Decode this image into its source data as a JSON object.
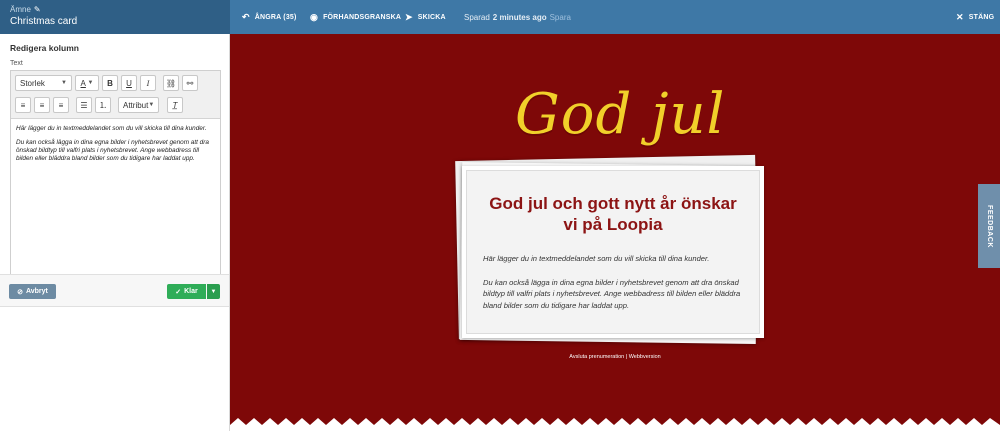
{
  "subject": {
    "label": "Ämne",
    "title": "Christmas card"
  },
  "topbar": {
    "undo": "ÅNGRA (35)",
    "preview": "FÖRHANDSGRANSKA",
    "send": "SKICKA",
    "saved_prefix": "Sparad",
    "saved_time": "2 minutes ago",
    "save_link": "Spara",
    "close": "STÄNG"
  },
  "panel": {
    "title": "Redigera kolumn",
    "field_label": "Text"
  },
  "toolbar": {
    "size_select": "Storlek",
    "attr_select": "Attribut"
  },
  "editor": {
    "p1": "Här lägger du in textmeddelandet som du vill skicka till dina kunder.",
    "p2": "Du kan också lägga in dina egna bilder i nyhetsbrevet genom att dra önskad bildtyp till valfri plats i nyhetsbrevet. Ange webbadress till bilden eller bläddra bland bilder som du tidigare har laddat upp."
  },
  "actions": {
    "cancel": "Avbryt",
    "done": "Klar"
  },
  "preview": {
    "script_title": "God jul",
    "heading": "God jul och gott nytt år önskar vi på Loopia",
    "p1": "Här lägger du in textmeddelandet som du vill skicka till dina kunder.",
    "p2": "Du kan också lägga in dina egna bilder i nyhetsbrevet genom att dra önskad bildtyp till valfri plats i nyhetsbrevet. Ange webbadress till bilden eller bläddra bland bilder som du tidigare har laddat upp.",
    "unsubscribe": "Avsluta prenumeration",
    "separator": "|",
    "webversion": "Webbversion"
  },
  "feedback": "FEEDBACK",
  "colors": {
    "topbar": "#3e78a6",
    "preview_bg": "#7e0808",
    "accent_gold": "#f1d02a",
    "heading_red": "#8c1414",
    "done_green": "#2fad58"
  }
}
